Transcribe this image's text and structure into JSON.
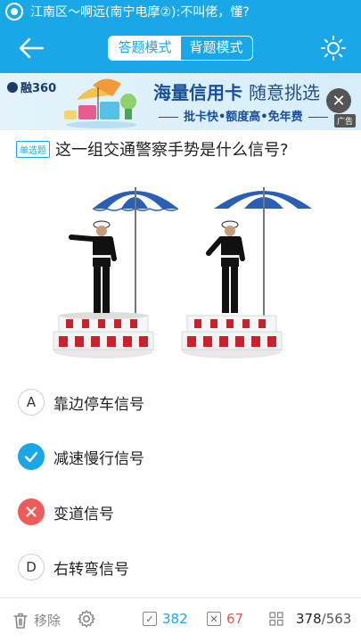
{
  "status_bar": {
    "text": "江南区～啊远(南宁电摩②):不叫佬，懂?"
  },
  "header": {
    "modes": [
      {
        "label": "答题模式",
        "active": true
      },
      {
        "label": "背题模式",
        "active": false
      }
    ]
  },
  "ad": {
    "logo": "融360",
    "headline_main": "海量信用卡",
    "headline_sub": "随意挑选",
    "subline": "批卡快•额度高•免年费",
    "close_symbol": "✕",
    "label": "广告"
  },
  "question": {
    "type_badge": "单选题",
    "text": "这一组交通警察手势是什么信号?"
  },
  "options": [
    {
      "key": "A",
      "label": "靠边停车信号",
      "state": "normal"
    },
    {
      "key": "B",
      "label": "减速慢行信号",
      "state": "correct"
    },
    {
      "key": "C",
      "label": "变道信号",
      "state": "wrong"
    },
    {
      "key": "D",
      "label": "右转弯信号",
      "state": "normal"
    }
  ],
  "bottom_bar": {
    "remove_label": "移除",
    "right_count": "382",
    "wrong_count": "67",
    "progress_current": "378",
    "progress_total": "/563"
  },
  "colors": {
    "accent": "#1aa7e8",
    "wrong": "#f05a5a"
  }
}
